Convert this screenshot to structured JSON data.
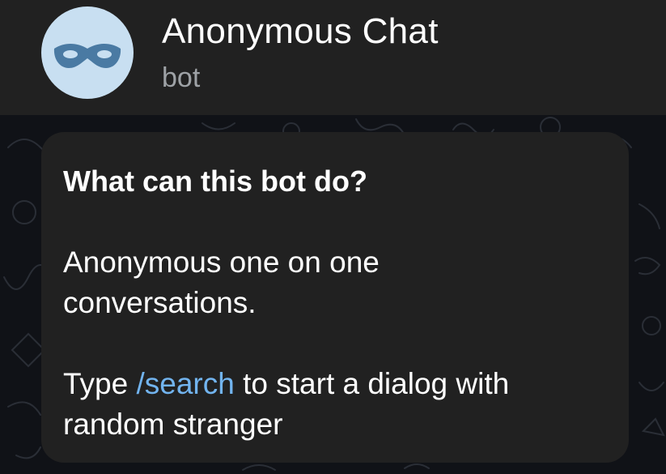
{
  "header": {
    "title": "Anonymous Chat",
    "subtitle": "bot"
  },
  "colors": {
    "header_bg": "#212121",
    "avatar_bg": "#c8dff1",
    "mask_color": "#4a7aa3",
    "bubble_bg": "#212121",
    "link_color": "#72b4ef",
    "muted_text": "#9ea2a6"
  },
  "avatar": {
    "icon": "mask-icon"
  },
  "bot_info": {
    "heading": "What can this bot do?",
    "description_line1": "Anonymous one on one",
    "description_line2": "conversations.",
    "usage_prefix": "Type ",
    "usage_command": "/search",
    "usage_suffix": " to start a dialog with",
    "usage_line2": "random stranger"
  }
}
